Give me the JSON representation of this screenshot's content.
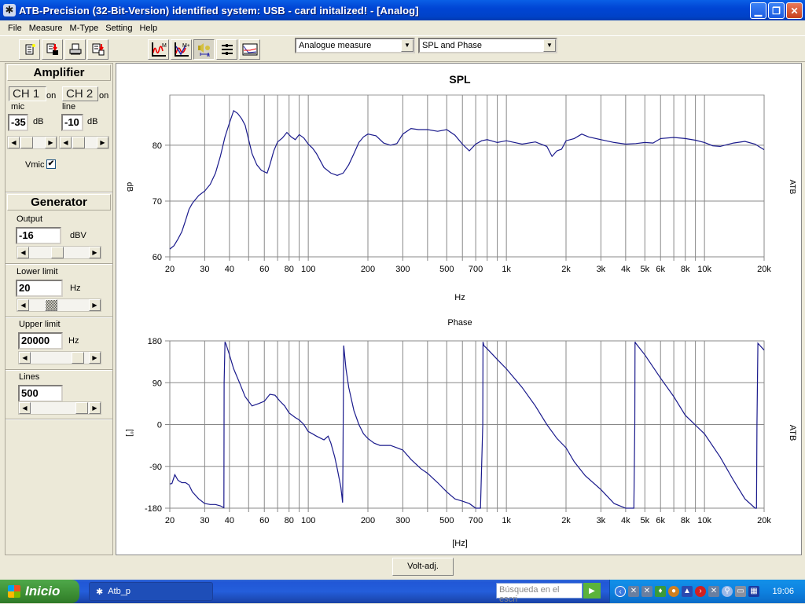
{
  "window": {
    "title": "ATB-Precision  (32-Bit-Version)  identified system: USB - card  initalized! - [Analog]",
    "buttons": [
      "minimize",
      "restore",
      "close"
    ]
  },
  "menu": [
    "File",
    "Measure",
    "M-Type",
    "Setting",
    "Help"
  ],
  "toolbar": {
    "file_buttons": [
      {
        "icon": "new-document-icon"
      },
      {
        "icon": "save-document-icon"
      },
      {
        "icon": "print-icon"
      },
      {
        "icon": "export-document-icon"
      }
    ],
    "measure_buttons": [
      {
        "icon": "measure-m-icon"
      },
      {
        "icon": "measure-m-plus-icon"
      },
      {
        "icon": "speaker-distance-icon",
        "active": true
      },
      {
        "icon": "settings-sliders-icon"
      },
      {
        "icon": "chart-compare-icon"
      }
    ],
    "measure_mode": "Analogue measure",
    "display_mode": "SPL and Phase"
  },
  "amplifier": {
    "header": "Amplifier",
    "ch1": {
      "label": "CH 1",
      "state": "on",
      "input": "mic",
      "gain": "-35",
      "unit": "dB"
    },
    "ch2": {
      "label": "CH 2",
      "state": "on",
      "input": "line",
      "gain": "-10",
      "unit": "dB"
    },
    "vmic_label": "Vmic",
    "vmic_checked": true
  },
  "generator": {
    "header": "Generator",
    "output": {
      "label": "Output",
      "value": "-16",
      "unit": "dBV"
    },
    "lower_limit": {
      "label": "Lower limit",
      "value": "20",
      "unit": "Hz"
    },
    "upper_limit": {
      "label": "Upper limit",
      "value": "20000",
      "unit": "Hz"
    },
    "lines": {
      "label": "Lines",
      "value": "500"
    }
  },
  "bottom": {
    "volt_adj": "Volt-adj."
  },
  "taskbar": {
    "start": "Inicio",
    "task": "Atb_p",
    "search_placeholder": "Búsqueda en el escri",
    "clock": "19:06"
  },
  "chart_data": [
    {
      "type": "line",
      "title": "SPL",
      "xlabel": "Hz",
      "ylabel": "dB",
      "side_label": "ATB",
      "xscale": "log",
      "xlim": [
        20,
        20000
      ],
      "ylim": [
        60,
        89
      ],
      "yticks": [
        60,
        70,
        80
      ],
      "xtick_values": [
        20,
        30,
        40,
        60,
        80,
        100,
        200,
        300,
        500,
        700,
        1000,
        2000,
        3000,
        4000,
        5000,
        6000,
        8000,
        10000,
        20000
      ],
      "xtick_labels": [
        "20",
        "30",
        "40",
        "60",
        "80",
        "100",
        "200",
        "300",
        "500",
        "700",
        "1k",
        "2k",
        "3k",
        "4k",
        "5k",
        "6k",
        "8k",
        "10k",
        "20k"
      ],
      "x_gridlines": [
        20,
        30,
        40,
        50,
        60,
        70,
        80,
        90,
        100,
        200,
        300,
        400,
        500,
        600,
        700,
        800,
        900,
        1000,
        2000,
        3000,
        4000,
        5000,
        6000,
        7000,
        8000,
        9000,
        10000,
        20000
      ],
      "grid": true,
      "series": [
        {
          "name": "SPL",
          "color": "#1a1a8c",
          "x": [
            20,
            21,
            22,
            23,
            24,
            25,
            26,
            27,
            28,
            30,
            32,
            34,
            36,
            38,
            40,
            42,
            44,
            46,
            48,
            50,
            52,
            55,
            58,
            62,
            64,
            67,
            70,
            74,
            78,
            82,
            86,
            90,
            95,
            100,
            105,
            110,
            120,
            130,
            140,
            150,
            160,
            170,
            180,
            190,
            200,
            220,
            240,
            260,
            280,
            300,
            330,
            360,
            400,
            450,
            500,
            550,
            600,
            650,
            700,
            750,
            800,
            900,
            1000,
            1100,
            1200,
            1400,
            1600,
            1700,
            1800,
            1900,
            2000,
            2200,
            2400,
            2600,
            3000,
            3500,
            4000,
            4500,
            5000,
            5500,
            6000,
            7000,
            8000,
            9000,
            10000,
            11000,
            12000,
            14000,
            16000,
            18000,
            20000
          ],
          "y": [
            61.4,
            62.0,
            63.2,
            64.5,
            66.5,
            68.5,
            69.6,
            70.3,
            71.0,
            71.8,
            73.0,
            75.0,
            78.0,
            81.5,
            84.0,
            86.2,
            85.7,
            84.8,
            83.6,
            81.0,
            78.5,
            76.5,
            75.5,
            75.0,
            76.5,
            79.0,
            80.6,
            81.3,
            82.3,
            81.5,
            81.0,
            81.9,
            81.3,
            80.2,
            79.5,
            78.5,
            76.0,
            75.0,
            74.6,
            75.0,
            76.5,
            78.5,
            80.5,
            81.5,
            82.0,
            81.7,
            80.4,
            80.0,
            80.3,
            82.0,
            83.0,
            82.8,
            82.8,
            82.5,
            82.8,
            81.8,
            80.2,
            79.0,
            80.2,
            80.8,
            81.0,
            80.5,
            80.8,
            80.5,
            80.2,
            80.6,
            79.8,
            78.0,
            79.0,
            79.3,
            80.8,
            81.2,
            82.0,
            81.5,
            81.0,
            80.5,
            80.2,
            80.3,
            80.5,
            80.4,
            81.2,
            81.4,
            81.2,
            80.9,
            80.5,
            79.9,
            79.8,
            80.4,
            80.7,
            80.2,
            79.2
          ]
        }
      ]
    },
    {
      "type": "line",
      "title": "Phase",
      "xlabel": "[Hz]",
      "ylabel": "[°]",
      "side_label": "ATB",
      "xscale": "log",
      "xlim": [
        20,
        20000
      ],
      "ylim": [
        -180,
        180
      ],
      "yticks": [
        -180,
        -90,
        0,
        90,
        180
      ],
      "xtick_values": [
        20,
        30,
        40,
        60,
        80,
        100,
        200,
        300,
        500,
        700,
        1000,
        2000,
        3000,
        4000,
        5000,
        6000,
        8000,
        10000,
        20000
      ],
      "xtick_labels": [
        "20",
        "30",
        "40",
        "60",
        "80",
        "100",
        "200",
        "300",
        "500",
        "700",
        "1k",
        "2k",
        "3k",
        "4k",
        "5k",
        "6k",
        "8k",
        "10k",
        "20k"
      ],
      "x_gridlines": [
        20,
        30,
        40,
        50,
        60,
        70,
        80,
        90,
        100,
        200,
        300,
        400,
        500,
        600,
        700,
        800,
        900,
        1000,
        2000,
        3000,
        4000,
        5000,
        6000,
        7000,
        8000,
        9000,
        10000,
        20000
      ],
      "grid": true,
      "series": [
        {
          "name": "Phase",
          "color": "#1a1a8c",
          "x": [
            20,
            20.5,
            21.2,
            22,
            23,
            24,
            25,
            26,
            28,
            30,
            32,
            34,
            36,
            37.5,
            37.6,
            38,
            38.5,
            40,
            42,
            45,
            48,
            52,
            56,
            60,
            64,
            68,
            72,
            76,
            80,
            86,
            90,
            95,
            100,
            105,
            110,
            120,
            126,
            130,
            136,
            140,
            146,
            149,
            149.5,
            151,
            155,
            160,
            170,
            180,
            190,
            200,
            215,
            230,
            245,
            260,
            280,
            300,
            330,
            370,
            400,
            450,
            500,
            550,
            600,
            650,
            700,
            740,
            760,
            762,
            770,
            800,
            900,
            1000,
            1200,
            1400,
            1600,
            1800,
            2000,
            2200,
            2500,
            3000,
            3500,
            4000,
            4400,
            4450,
            4460,
            4500,
            5000,
            6000,
            7000,
            8000,
            10000,
            12000,
            14000,
            16000,
            18000,
            18300,
            18400,
            18600,
            20000
          ],
          "y": [
            -128,
            -127,
            -108,
            -120,
            -125,
            -125,
            -130,
            -145,
            -160,
            -170,
            -172,
            -172,
            -175,
            -179,
            90,
            178,
            172,
            150,
            120,
            90,
            60,
            40,
            45,
            50,
            65,
            63,
            50,
            40,
            25,
            15,
            10,
            0,
            -15,
            -20,
            -25,
            -33,
            -25,
            -40,
            -70,
            -95,
            -135,
            -168,
            -90,
            170,
            120,
            80,
            30,
            0,
            -20,
            -30,
            -40,
            -45,
            -45,
            -45,
            -50,
            -55,
            -75,
            -95,
            -105,
            -125,
            -145,
            -160,
            -165,
            -170,
            -180,
            -180,
            0,
            178,
            170,
            163,
            140,
            120,
            80,
            40,
            0,
            -30,
            -50,
            -80,
            -110,
            -140,
            -170,
            -180,
            -180,
            0,
            178,
            175,
            150,
            100,
            60,
            20,
            -20,
            -70,
            -120,
            -160,
            -180,
            -180,
            0,
            175,
            160
          ]
        }
      ]
    }
  ]
}
